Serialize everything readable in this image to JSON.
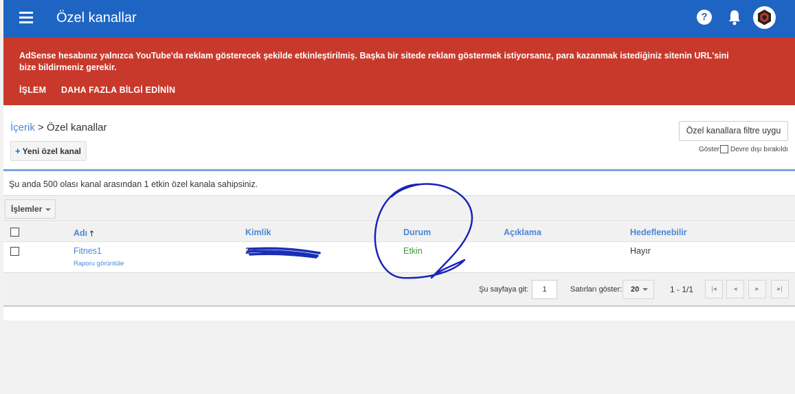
{
  "header": {
    "title": "Özel kanallar",
    "help_glyph": "?",
    "bar_color": "#1e65c3"
  },
  "banner": {
    "message": "AdSense hesabınız yalnızca YouTube'da reklam gösterecek şekilde etkinleştirilmiş. Başka bir sitede reklam göstermek istiyorsanız, para kazanmak istediğiniz sitenin URL'sini bize bildirmeniz gerekir.",
    "action_1": "İŞLEM",
    "action_2": "DAHA FAZLA BİLGİ EDİNİN",
    "color": "#c8392c"
  },
  "breadcrumb": {
    "parent": "İçerik",
    "separator": " > ",
    "current": "Özel kanallar"
  },
  "buttons": {
    "new_channel_plus": "+",
    "new_channel": "Yeni özel kanal",
    "filter": "Özel kanallara filtre uygu",
    "actions": "İşlemler"
  },
  "show_filter": {
    "label": "Göster",
    "option": "Devre dışı bırakıldı"
  },
  "summary": "Şu anda 500 olası kanal arasından 1 etkin özel kanala sahipsiniz.",
  "table": {
    "columns": {
      "name": "Adı",
      "sort_arrow": "🡑",
      "id": "Kimlik",
      "status": "Durum",
      "description": "Açıklama",
      "targetable": "Hedeflenebilir"
    },
    "rows": [
      {
        "name": "Fitnes1",
        "sub_link": "Raporu görüntüle",
        "id_visible": "2",
        "status": "Etkin",
        "description": "",
        "targetable": "Hayır"
      }
    ]
  },
  "pager": {
    "go_to_page_label": "Şu sayfaya git:",
    "page_value": "1",
    "rows_label": "Satırları göster:",
    "rows_value": "20",
    "range": "1 - 1/1",
    "first_glyph": "|◂",
    "prev_glyph": "◂",
    "next_glyph": "▸",
    "last_glyph": "▸|"
  },
  "icons": {
    "menu": "menu-icon",
    "help": "help-icon",
    "notifications": "bell-icon",
    "account": "avatar"
  }
}
